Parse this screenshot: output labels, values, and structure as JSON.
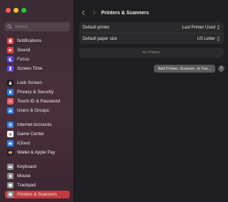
{
  "window": {
    "title": "Printers & Scanners",
    "traffic_colors": [
      "#ff5f57",
      "#febc2e",
      "#28c840"
    ]
  },
  "search": {
    "placeholder": "Search"
  },
  "sidebar": {
    "items": [
      {
        "label": "Notifications",
        "icon": "bell-icon",
        "color": "#e0453d"
      },
      {
        "label": "Sound",
        "icon": "speaker-icon",
        "color": "#e0453d"
      },
      {
        "label": "Focus",
        "icon": "moon-icon",
        "color": "#5b4bd6"
      },
      {
        "label": "Screen Time",
        "icon": "hourglass-icon",
        "color": "#5b4bd6"
      },
      {
        "label": "Lock Screen",
        "icon": "lock-icon",
        "color": "#1b1b1d"
      },
      {
        "label": "Privacy & Security",
        "icon": "hand-icon",
        "color": "#2f7fe0"
      },
      {
        "label": "Touch ID & Password",
        "icon": "fingerprint-icon",
        "color": "#e9596a"
      },
      {
        "label": "Users & Groups",
        "icon": "users-icon",
        "color": "#2f7fe0"
      },
      {
        "label": "Internet Accounts",
        "icon": "at-icon",
        "color": "#2f7fe0"
      },
      {
        "label": "Game Center",
        "icon": "game-center-icon",
        "color": "#ffffff"
      },
      {
        "label": "iCloud",
        "icon": "cloud-icon",
        "color": "#2f7fe0"
      },
      {
        "label": "Wallet & Apple Pay",
        "icon": "wallet-icon",
        "color": "#222222"
      },
      {
        "label": "Keyboard",
        "icon": "keyboard-icon",
        "color": "#8a8a8e"
      },
      {
        "label": "Mouse",
        "icon": "mouse-icon",
        "color": "#8a8a8e"
      },
      {
        "label": "Trackpad",
        "icon": "trackpad-icon",
        "color": "#8a8a8e"
      },
      {
        "label": "Printers & Scanners",
        "icon": "printer-icon",
        "color": "#8a8a8e",
        "selected": true
      }
    ],
    "selected_color": "#c23a3f"
  },
  "settings": {
    "default_printer_label": "Default printer",
    "default_printer_value": "Last Printer Used",
    "paper_size_label": "Default paper size",
    "paper_size_value": "US Letter",
    "no_printers_text": "No Printers"
  },
  "actions": {
    "add_label": "Add Printer, Scanner, or Fax...",
    "help_label": "?"
  }
}
